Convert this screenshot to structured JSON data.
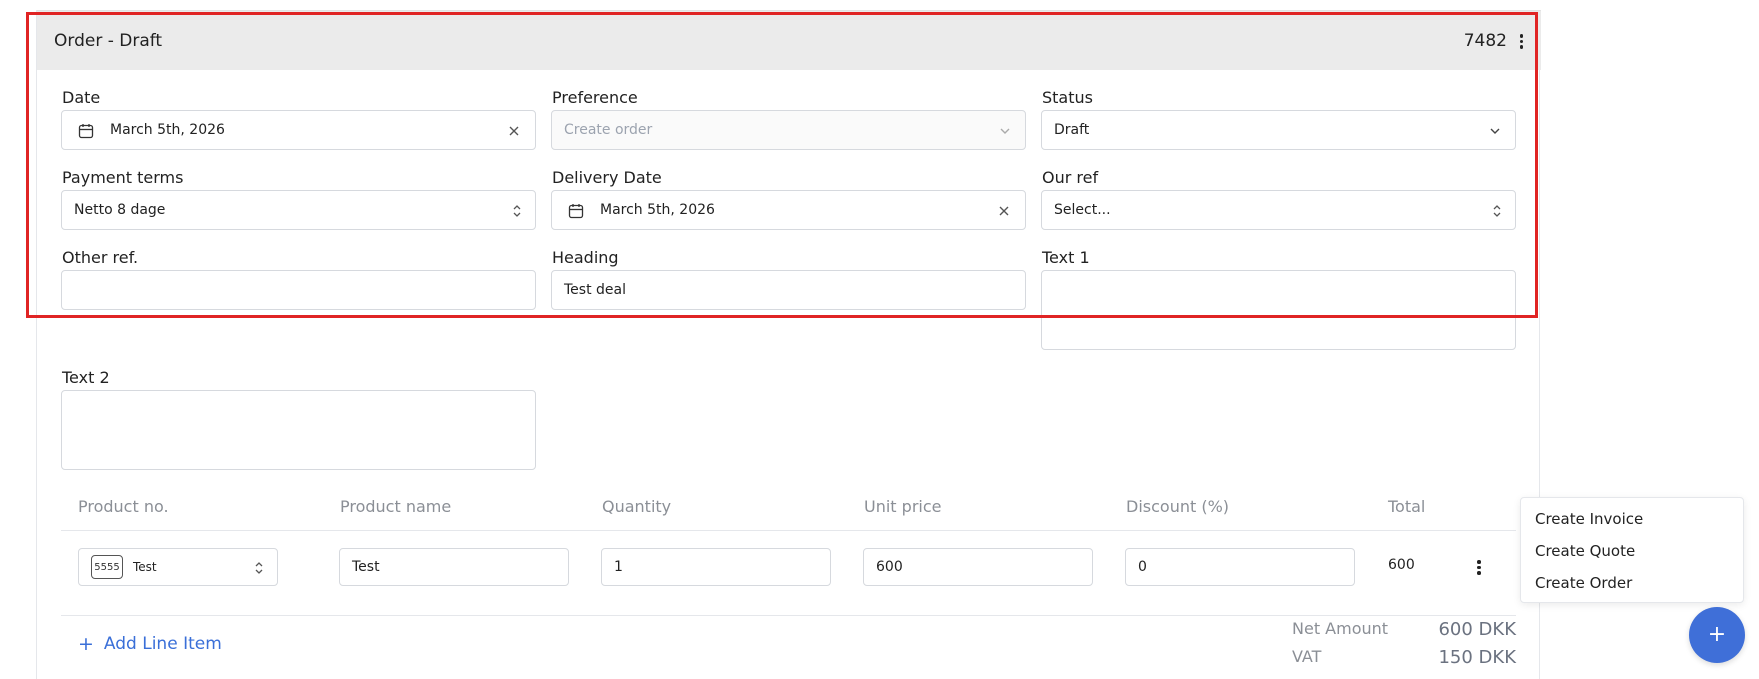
{
  "header": {
    "title": "Order - Draft",
    "number": "7482"
  },
  "fields": {
    "date": {
      "label": "Date",
      "value": "March 5th, 2026"
    },
    "preference": {
      "label": "Preference",
      "placeholder": "Create order"
    },
    "status": {
      "label": "Status",
      "value": "Draft"
    },
    "payment_terms": {
      "label": "Payment terms",
      "value": "Netto 8 dage"
    },
    "delivery_date": {
      "label": "Delivery Date",
      "value": "March 5th, 2026"
    },
    "our_ref": {
      "label": "Our ref",
      "placeholder": "Select..."
    },
    "other_ref": {
      "label": "Other ref.",
      "value": ""
    },
    "heading": {
      "label": "Heading",
      "value": "Test deal"
    },
    "text1": {
      "label": "Text 1",
      "value": ""
    },
    "text2": {
      "label": "Text 2",
      "value": ""
    }
  },
  "table": {
    "columns": [
      "Product no.",
      "Product name",
      "Quantity",
      "Unit price",
      "Discount (%)",
      "Total"
    ],
    "rows": [
      {
        "product_no": "5555",
        "product_label": "Test",
        "product_name": "Test",
        "quantity": "1",
        "unit_price": "600",
        "discount": "0",
        "total": "600"
      }
    ]
  },
  "add_line_label": "Add Line Item",
  "summary": {
    "net_label": "Net Amount",
    "net_value": "600 DKK",
    "vat_label": "VAT",
    "vat_value": "150 DKK"
  },
  "menu": {
    "items": [
      "Create Invoice",
      "Create Quote",
      "Create Order"
    ]
  },
  "fab_label": "+",
  "colors": {
    "accent": "#3f6fd8",
    "highlight": "#e02424",
    "header_bg": "#ebebeb"
  },
  "icons": [
    "calendar-icon",
    "close-icon",
    "chevron-down-icon",
    "updown-icon",
    "kebab-icon",
    "plus-icon"
  ]
}
